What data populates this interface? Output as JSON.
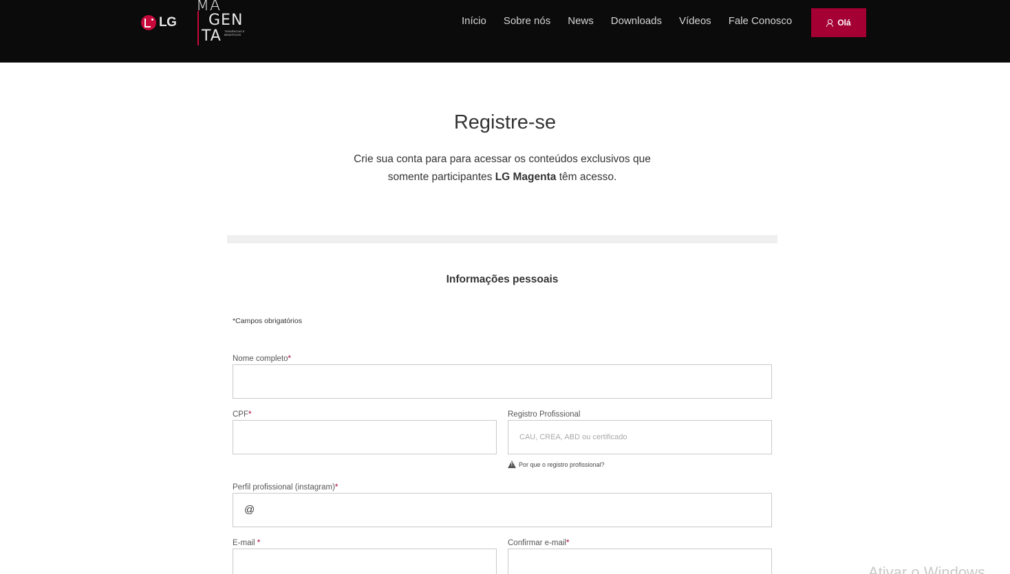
{
  "header": {
    "lg_label": "LG",
    "magenta_line1": "MA",
    "magenta_line2": "GEN",
    "magenta_line3": "TA",
    "magenta_sub": "TENDÊNCIAS E BENEFÍCIOS",
    "nav": [
      "Início",
      "Sobre nós",
      "News",
      "Downloads",
      "Vídeos",
      "Fale Conosco"
    ],
    "user_button": "Olá"
  },
  "intro": {
    "title": "Registre-se",
    "text_line1": "Crie sua conta para para acessar os conteúdos exclusivos que",
    "text_line2_pre": "somente participantes ",
    "text_line2_bold": "LG Magenta",
    "text_line2_post": " têm acesso."
  },
  "form": {
    "section_title": "Informações pessoais",
    "required_note": "*Campos obrigatórios",
    "full_name_label": "Nome completo",
    "cpf_label": "CPF",
    "registro_label": "Registro Profissional",
    "registro_placeholder": "CAU, CREA, ABD ou certificado",
    "registro_hint": "Por que o registro profissional?",
    "instagram_label": "Perfil profissional (instagram)",
    "instagram_prefix": "@",
    "email_label": "E-mail ",
    "confirm_email_label": "Confirmar e-mail",
    "star": "*"
  },
  "overlay": {
    "watermark": "Ativar o Windows"
  },
  "colors": {
    "header_bg": "#0b0b0b",
    "accent": "#a50034",
    "lg_red": "#c6093b"
  }
}
